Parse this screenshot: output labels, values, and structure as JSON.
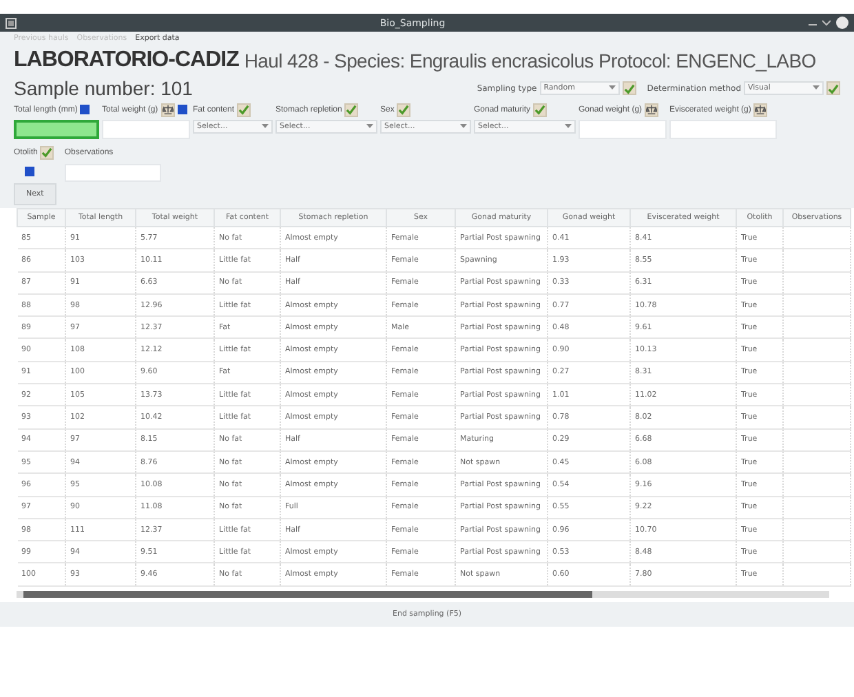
{
  "window": {
    "title": "Bio_Sampling"
  },
  "breadcrumbs": [
    {
      "label": "Previous hauls",
      "disabled": true
    },
    {
      "label": "Observations",
      "disabled": true
    },
    {
      "label": "Export data",
      "disabled": false
    }
  ],
  "header": {
    "lab": "LABORATORIO-CADIZ",
    "details": "Haul 428 - Species: Engraulis encrasicolus Protocol: ENGENC_LABO"
  },
  "sample_number": "Sample number: 101",
  "selectors": [
    {
      "label": "Sampling type",
      "value": "Random"
    },
    {
      "label": "Determination method",
      "value": "Visual"
    }
  ],
  "fields": [
    {
      "label": "Total length (mm)",
      "kind": "text",
      "active": true,
      "tools": [
        {
          "kind": "check",
          "checked": true
        }
      ]
    },
    {
      "label": "Total weight (g)",
      "kind": "text",
      "active": false,
      "tools": [
        {
          "kind": "scale"
        },
        {
          "kind": "check",
          "checked": true
        }
      ]
    },
    {
      "label": "Fat content",
      "kind": "select",
      "placeholder": "Select...",
      "active": false,
      "tools": [
        {
          "kind": "confirm"
        }
      ]
    },
    {
      "label": "Stomach repletion",
      "kind": "select",
      "placeholder": "Select...",
      "active": false,
      "tools": [
        {
          "kind": "confirm"
        }
      ]
    },
    {
      "label": "Sex",
      "kind": "select",
      "placeholder": "Select...",
      "active": false,
      "tools": [
        {
          "kind": "confirm"
        }
      ]
    },
    {
      "label": "Gonad maturity",
      "kind": "select",
      "placeholder": "Select...",
      "active": false,
      "tools": [
        {
          "kind": "confirm"
        }
      ]
    },
    {
      "label": "Gonad weight (g)",
      "kind": "text",
      "active": false,
      "tools": [
        {
          "kind": "scale"
        }
      ]
    },
    {
      "label": "Eviscerated weight (g)",
      "kind": "text",
      "active": false,
      "tools": [
        {
          "kind": "scale"
        }
      ]
    }
  ],
  "otolith": {
    "label": "Otolith",
    "checked": true
  },
  "observations": {
    "label": "Observations"
  },
  "next_button": "Next",
  "table": {
    "columns": [
      "Sample",
      "Total length",
      "Total weight",
      "Fat content",
      "Stomach repletion",
      "Sex",
      "Gonad maturity",
      "Gonad weight",
      "Eviscerated weight",
      "Otolith",
      "Observations"
    ],
    "rows": [
      [
        "85",
        "91",
        "5.77",
        "No fat",
        "Almost empty",
        "Female",
        "Partial Post spawning",
        "0.41",
        "8.41",
        "True",
        ""
      ],
      [
        "86",
        "103",
        "10.11",
        "Little fat",
        "Half",
        "Female",
        "Spawning",
        "1.93",
        "8.55",
        "True",
        ""
      ],
      [
        "87",
        "91",
        "6.63",
        "No fat",
        "Half",
        "Female",
        "Partial Post spawning",
        "0.33",
        "6.31",
        "True",
        ""
      ],
      [
        "88",
        "98",
        "12.96",
        "Little fat",
        "Almost empty",
        "Female",
        "Partial Post spawning",
        "0.77",
        "10.78",
        "True",
        ""
      ],
      [
        "89",
        "97",
        "12.37",
        "Fat",
        "Almost empty",
        "Male",
        "Partial Post spawning",
        "0.48",
        "9.61",
        "True",
        ""
      ],
      [
        "90",
        "108",
        "12.12",
        "Little fat",
        "Almost empty",
        "Female",
        "Partial Post spawning",
        "0.90",
        "10.13",
        "True",
        ""
      ],
      [
        "91",
        "100",
        "9.60",
        "Fat",
        "Almost empty",
        "Female",
        "Partial Post spawning",
        "0.27",
        "8.31",
        "True",
        ""
      ],
      [
        "92",
        "105",
        "13.73",
        "Little fat",
        "Almost empty",
        "Female",
        "Partial Post spawning",
        "1.01",
        "11.02",
        "True",
        ""
      ],
      [
        "93",
        "102",
        "10.42",
        "Little fat",
        "Almost empty",
        "Female",
        "Partial Post spawning",
        "0.78",
        "8.02",
        "True",
        ""
      ],
      [
        "94",
        "97",
        "8.15",
        "No fat",
        "Half",
        "Female",
        "Maturing",
        "0.29",
        "6.68",
        "True",
        ""
      ],
      [
        "95",
        "94",
        "8.76",
        "No fat",
        "Almost empty",
        "Female",
        "Not spawn",
        "0.45",
        "6.08",
        "True",
        ""
      ],
      [
        "96",
        "95",
        "10.08",
        "No fat",
        "Almost empty",
        "Female",
        "Partial Post spawning",
        "0.54",
        "9.16",
        "True",
        ""
      ],
      [
        "97",
        "90",
        "11.08",
        "No fat",
        "Full",
        "Female",
        "Partial Post spawning",
        "0.55",
        "9.22",
        "True",
        ""
      ],
      [
        "98",
        "111",
        "12.37",
        "Little fat",
        "Half",
        "Female",
        "Partial Post spawning",
        "0.96",
        "10.70",
        "True",
        ""
      ],
      [
        "99",
        "94",
        "9.51",
        "Little fat",
        "Almost empty",
        "Female",
        "Partial Post spawning",
        "0.53",
        "8.48",
        "True",
        ""
      ],
      [
        "100",
        "93",
        "9.46",
        "No fat",
        "Almost empty",
        "Female",
        "Not spawn",
        "0.60",
        "7.80",
        "True",
        ""
      ]
    ]
  },
  "status_button": "End sampling (F5)"
}
